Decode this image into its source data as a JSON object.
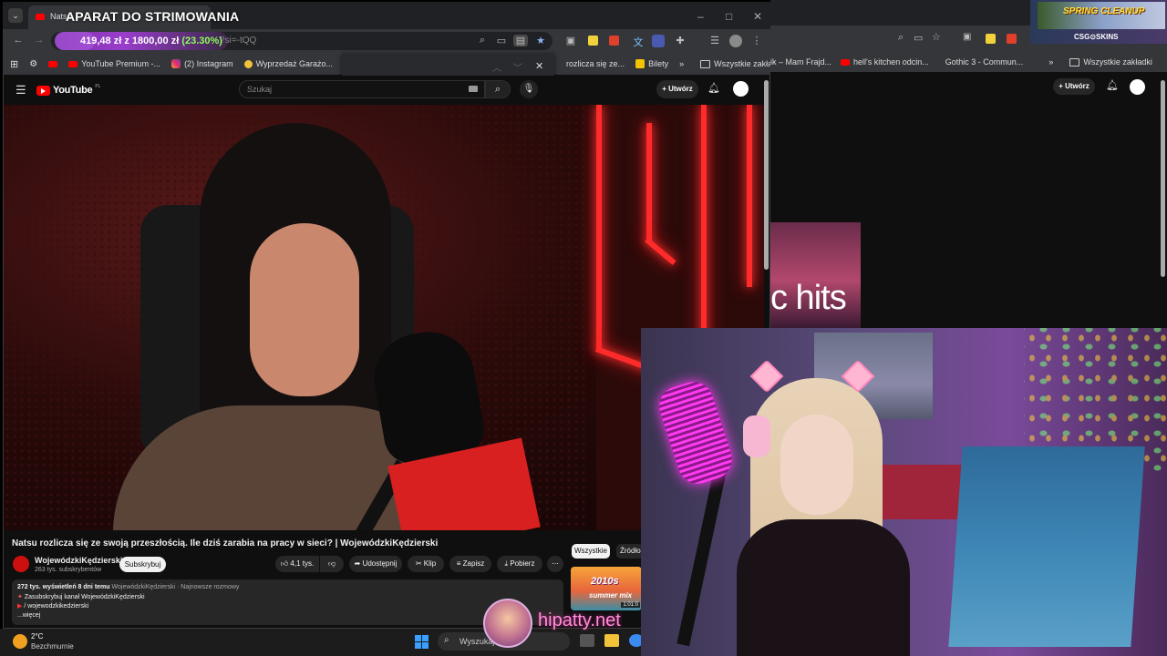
{
  "stream": {
    "title": "APARAT DO STRIMOWANIA",
    "goal_current": "419,48 zł",
    "goal_separator": "z",
    "goal_target": "1800,00 zł",
    "goal_percent": "(23.30%)",
    "goal_progress": 0.233
  },
  "browser": {
    "tab_title": "Natsu",
    "url_fragment": "?si=-tQQ",
    "window_controls": [
      "–",
      "□",
      "✕"
    ]
  },
  "bookmarks": [
    {
      "label": "",
      "icon": "settings-icon"
    },
    {
      "label": "",
      "icon": "youtube-icon"
    },
    {
      "label": "YouTube Premium -...",
      "icon": "youtube-icon"
    },
    {
      "label": "(2) Instagram",
      "icon": "instagram-icon"
    },
    {
      "label": "Wyprzedaż Garażo...",
      "icon": "dot-icon"
    },
    {
      "label": "rozlicza się ze...",
      "icon": "youtube-icon"
    },
    {
      "label": "Bilety",
      "icon": "ticket-icon"
    }
  ],
  "bookmarks_more": "»",
  "bookmarks_folder": "Wszystkie zakładki",
  "second_bookmarks": [
    {
      "label": "ik – Mam Frajd...",
      "icon": "youtube-icon"
    },
    {
      "label": "hell's kitchen odcin...",
      "icon": "youtube-icon"
    },
    {
      "label": "Gothic 3 - Commun...",
      "icon": "page-icon"
    }
  ],
  "youtube": {
    "logo": "YouTube",
    "logo_region": "PL",
    "search_placeholder": "Szukaj",
    "create_label": "Utwórz",
    "video_title": "Natsu rozlicza się ze swoją przeszłością. Ile dziś zarabia na pracy w sieci? | WojewódzkiKędzierski",
    "channel_name": "WojewódzkiKędzierski",
    "channel_subs": "263 tys. subskrybentów",
    "subscribe_label": "Subskrybuj",
    "likes": "4,1 tys.",
    "share_label": "Udostępnij",
    "clip_label": "Klip",
    "save_label": "Zapisz",
    "download_label": "Pobierz",
    "more_label": "⋯",
    "description": {
      "views": "272 tys. wyświetleń",
      "age": "8 dni temu",
      "tags": "WojewódzkiKędzierski · Najnowsze rozmowy",
      "line2": "Zasubskrybuj kanał WojewódzkiKędzierski",
      "line3": "/ wojewodzkikedzierski",
      "more": "...więcej"
    },
    "chips": [
      "Wszystkie",
      "Źródło"
    ],
    "rec_thumb_title": "2010s",
    "rec_thumb_sub": "summer mix",
    "rec_thumb_time": "1:01:0",
    "second_create_label": "Utwórz"
  },
  "cover": {
    "text": "c hits"
  },
  "taskbar": {
    "temperature": "2°C",
    "weather": "Bezchmurnie",
    "search_placeholder": "Wyszukaj"
  },
  "overlay": {
    "hipatty": "hipatty.net",
    "csgo_title": "SPRING CLEANUP",
    "csgo_logo": "CSG⊙SKINS"
  },
  "colors": {
    "youtube_red": "#ff0000",
    "goal_bar": "#9a3dcc",
    "goal_percent": "#8cff5a",
    "hipatty_pink": "#ff8ed8"
  }
}
